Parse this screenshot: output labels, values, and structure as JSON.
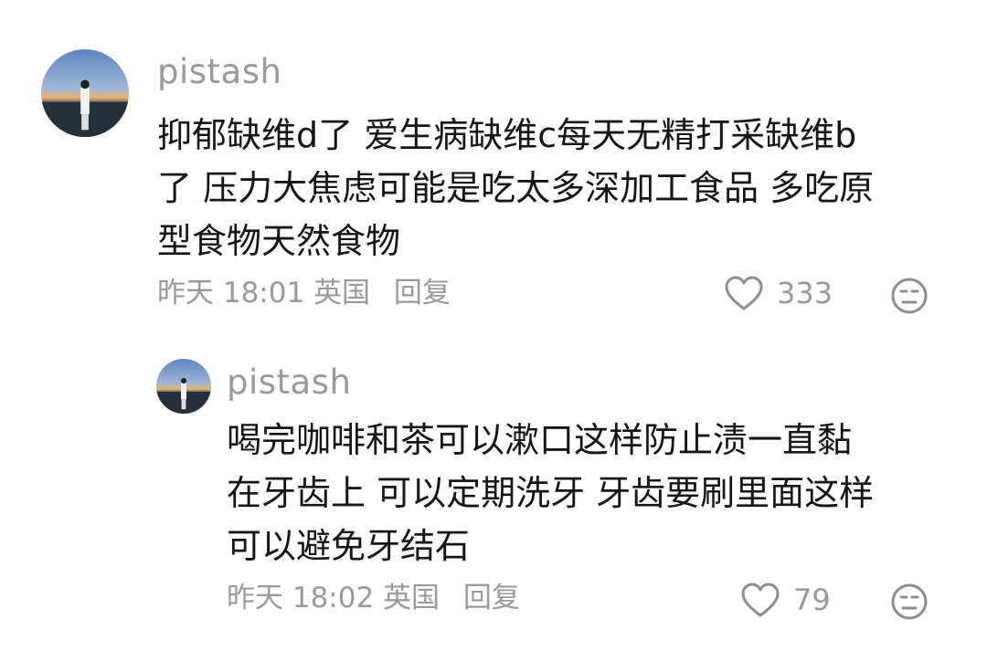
{
  "comments": [
    {
      "username": "pistash",
      "lines": [
        "抑郁缺维d了 爱生病缺维c每天无精打采缺维b",
        "了 压力大焦虑可能是吃太多深加工食品 多吃原",
        "型食物天然食物"
      ],
      "time": "昨天 18:01",
      "location": "英国",
      "reply_label": "回复",
      "like_count": "333",
      "like_icon": "heart-outline-icon",
      "reaction_icon": "unamused-face-icon"
    },
    {
      "username": "pistash",
      "lines": [
        "喝完咖啡和茶可以漱口这样防止渍一直黏",
        "在牙齿上 可以定期洗牙 牙齿要刷里面这样",
        "可以避免牙结石"
      ],
      "time": "昨天 18:02",
      "location": "英国",
      "reply_label": "回复",
      "like_count": "79",
      "like_icon": "heart-outline-icon",
      "reaction_icon": "unamused-face-icon"
    }
  ],
  "colors": {
    "text": "#161616",
    "meta": "#9a9a9a",
    "avatar_sky": "#6a8fc4",
    "avatar_horizon": "#e8b270"
  }
}
